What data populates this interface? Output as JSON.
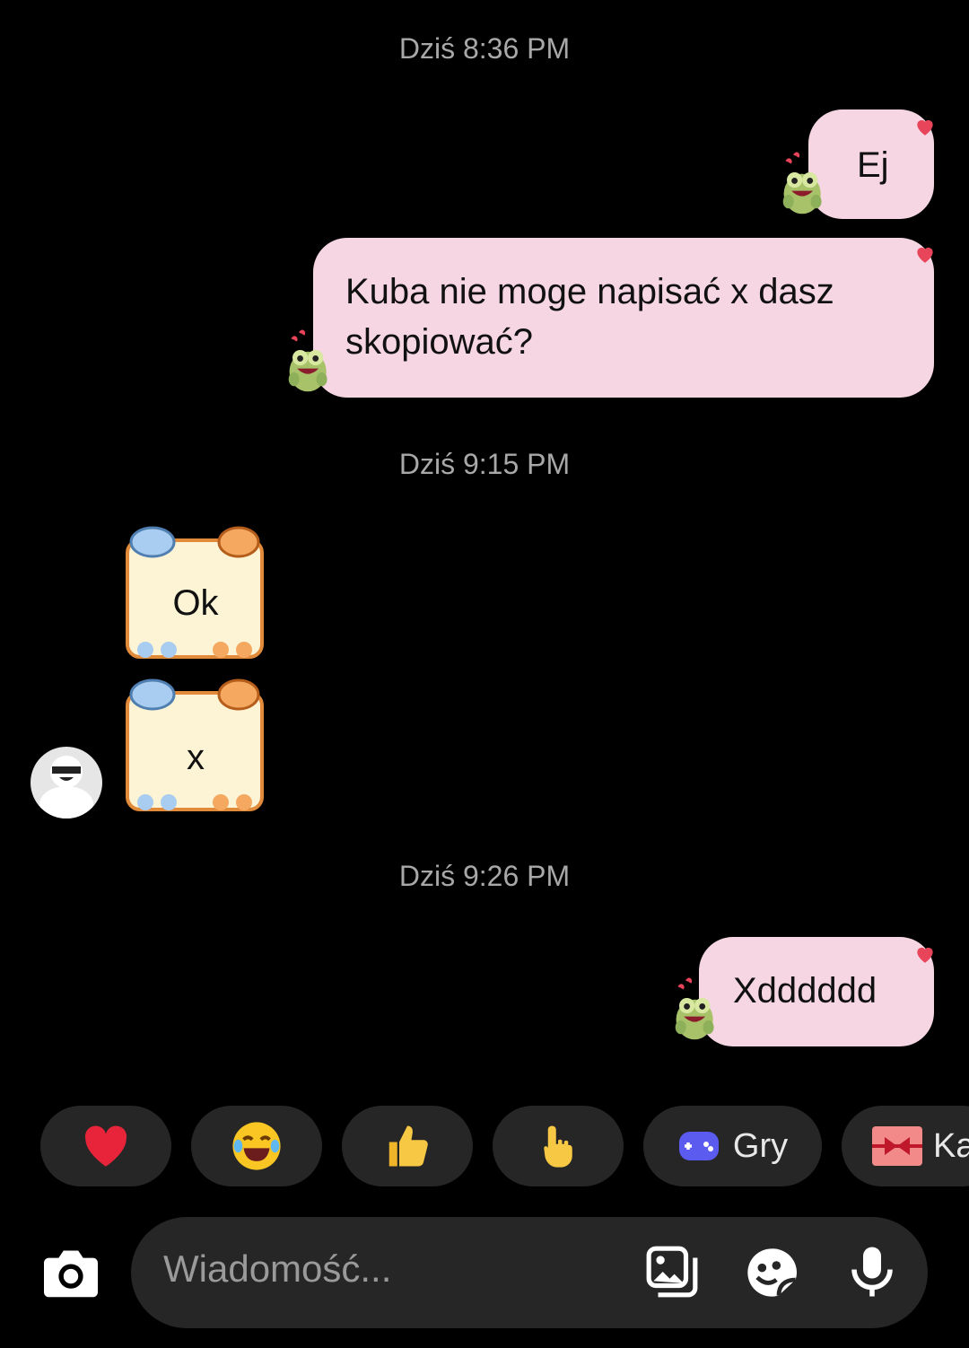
{
  "timestamps": [
    "Dziś 8:36 PM",
    "Dziś 9:15 PM",
    "Dziś 9:26 PM"
  ],
  "messages_outgoing": [
    {
      "text": "Ej"
    },
    {
      "text_line1": "Kuba nie moge napisać x dasz",
      "text_line2": "skopiować?"
    },
    {
      "text": "Xdddddd"
    }
  ],
  "messages_incoming": [
    {
      "text": "Ok"
    },
    {
      "text": "x"
    }
  ],
  "quick_actions": [
    {
      "icon": "heart-emoji-icon",
      "glyph": "❤️"
    },
    {
      "icon": "laugh-emoji-icon",
      "glyph": "😂"
    },
    {
      "icon": "thumbs-up-emoji-icon",
      "glyph": "👍"
    },
    {
      "icon": "pointing-hand-emoji-icon",
      "glyph": "👆"
    },
    {
      "icon": "gamepad-icon",
      "label": "Gry"
    },
    {
      "icon": "gift-icon",
      "label": "Ka"
    }
  ],
  "composer": {
    "placeholder": "Wiadomość..."
  },
  "colors": {
    "bubble_outgoing": "#f6d6e2",
    "background": "#000000",
    "timestamp": "#a8a8a8",
    "chip": "#262626",
    "heart": "#e8445a"
  }
}
